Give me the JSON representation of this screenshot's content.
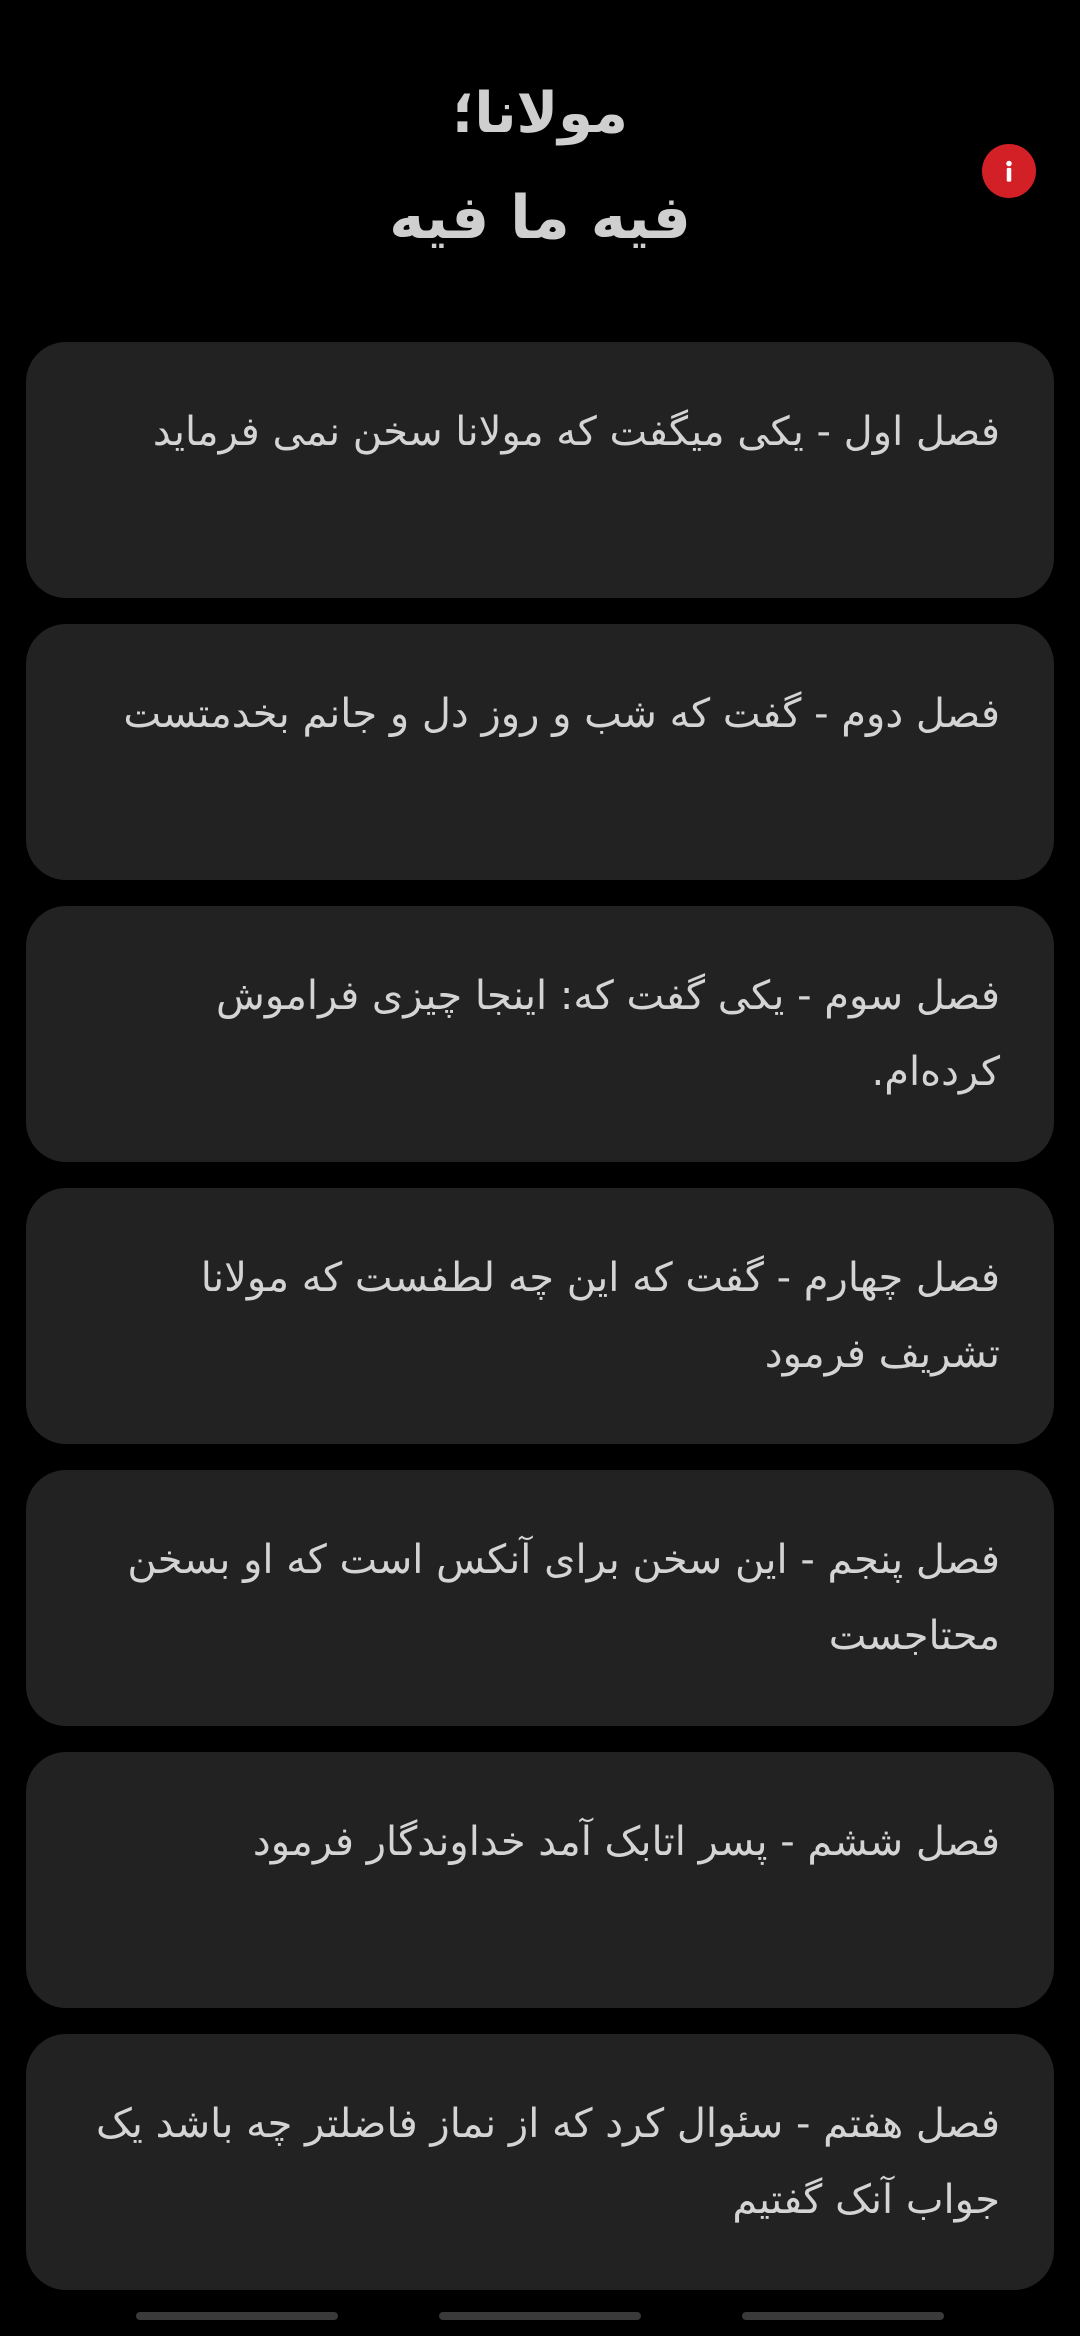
{
  "header": {
    "title_line1": "مولانا؛",
    "title_line2": "فیه ما فیه",
    "info_icon": "info-icon",
    "info_color": "#d32027"
  },
  "chapters": [
    {
      "text": "فصل اول - یکی میگفت که مولانا سخن نمی فرماید"
    },
    {
      "text": "فصل دوم - گفت که شب و روز دل و جانم بخدمتست"
    },
    {
      "text": "فصل سوم - یکی گفت که: اینجا چیزی فراموش کرده‌ام."
    },
    {
      "text": "فصل چهارم - گفت که این چه لطفست که مولانا تشریف فرمود"
    },
    {
      "text": "فصل پنجم - این سخن برای آنکس است که او بسخن محتاجست"
    },
    {
      "text": "فصل ششم - پسر اتابک آمد خداوندگار فرمود"
    },
    {
      "text": "فصل هفتم - سئوال کرد که از نماز فاضلتر چه باشد یک جواب آنک گفتیم"
    }
  ],
  "colors": {
    "background": "#000000",
    "card": "#222222",
    "text": "#d4d4d4"
  }
}
